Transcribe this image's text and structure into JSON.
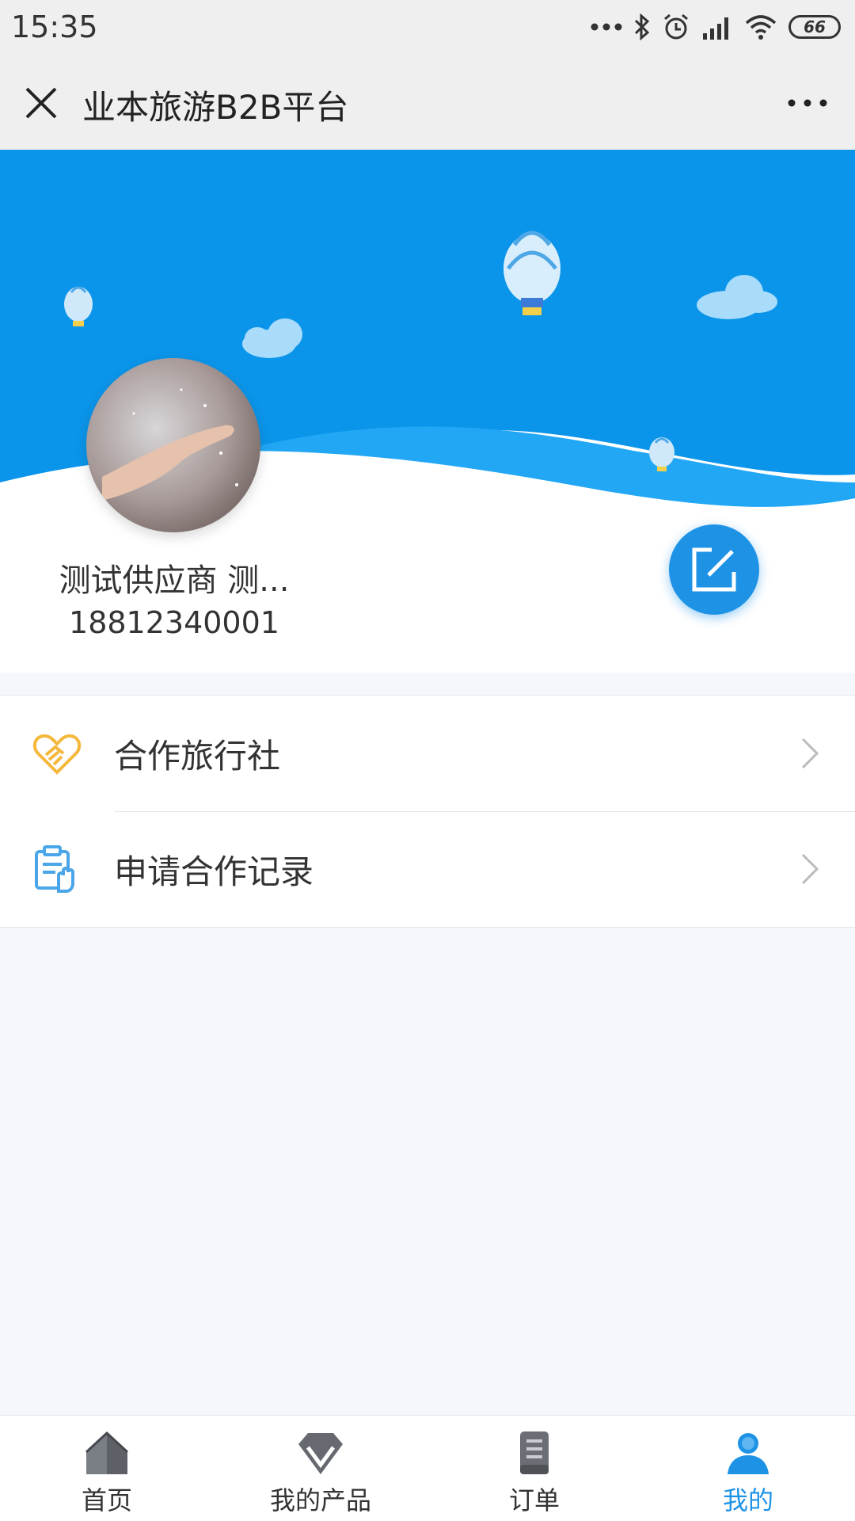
{
  "status_bar": {
    "time": "15:35",
    "battery": "66",
    "icons": [
      "more-dots-icon",
      "bluetooth-icon",
      "alarm-icon",
      "signal-icon",
      "wifi-icon",
      "battery-icon"
    ]
  },
  "header": {
    "title": "业本旅游B2B平台"
  },
  "profile": {
    "name": "测试供应商 测...",
    "phone": "18812340001"
  },
  "menu": {
    "items": [
      {
        "label": "合作旅行社",
        "icon": "handshake-icon"
      },
      {
        "label": "申请合作记录",
        "icon": "application-record-icon"
      }
    ]
  },
  "bottom_nav": {
    "items": [
      {
        "label": "首页",
        "icon": "home-icon",
        "active": false
      },
      {
        "label": "我的产品",
        "icon": "diamond-icon",
        "active": false
      },
      {
        "label": "订单",
        "icon": "order-icon",
        "active": false
      },
      {
        "label": "我的",
        "icon": "user-icon",
        "active": true
      }
    ]
  },
  "colors": {
    "accent": "#1e93e6",
    "banner_blue": "#0b95ea",
    "banner_wave": "#22a7f5",
    "handshake": "#f5b83c",
    "page_bg": "#f4f7fc"
  }
}
